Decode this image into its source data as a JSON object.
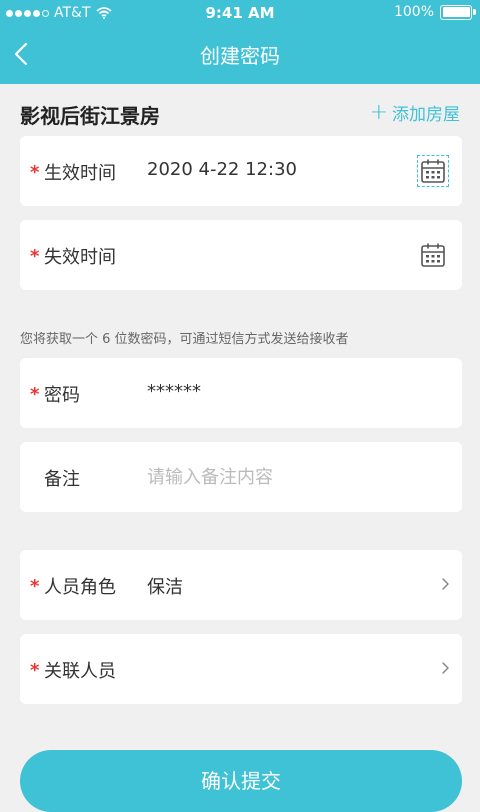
{
  "status": {
    "carrier": "AT&T",
    "time": "9:41 AM",
    "battery": "100%"
  },
  "nav": {
    "title": "创建密码"
  },
  "house": {
    "name": "影视后街江景房",
    "add_label": "添加房屋"
  },
  "fields": {
    "effective_time": {
      "label": "生效时间",
      "value": "2020 4-22 12:30"
    },
    "expire_time": {
      "label": "失效时间",
      "value": ""
    },
    "password": {
      "label": "密码",
      "value": "******"
    },
    "note": {
      "label": "备注",
      "placeholder": "请输入备注内容"
    },
    "role": {
      "label": "人员角色",
      "value": "保洁"
    },
    "related_person": {
      "label": "关联人员"
    }
  },
  "hint": "您将获取一个 6 位数密码，可通过短信方式发送给接收者",
  "submit_label": "确认提交",
  "colors": {
    "accent": "#3fc1d6",
    "required": "#e33333"
  }
}
